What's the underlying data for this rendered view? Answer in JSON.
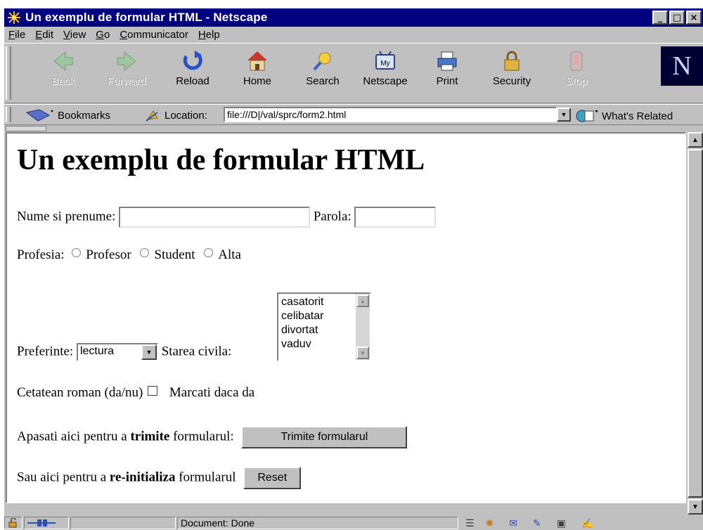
{
  "window": {
    "title": "Un exemplu de formular HTML - Netscape",
    "minimize": "_",
    "maximize": "□",
    "close": "×"
  },
  "menubar": {
    "items": [
      {
        "label": "File",
        "accel": "F",
        "rest": "ile"
      },
      {
        "label": "Edit",
        "accel": "E",
        "rest": "dit"
      },
      {
        "label": "View",
        "accel": "V",
        "rest": "iew"
      },
      {
        "label": "Go",
        "accel": "G",
        "rest": "o"
      },
      {
        "label": "Communicator",
        "accel": "C",
        "rest": "ommunicator"
      },
      {
        "label": "Help",
        "accel": "H",
        "rest": "elp"
      }
    ]
  },
  "toolbar": {
    "back": "Back",
    "forward": "Forward",
    "reload": "Reload",
    "home": "Home",
    "search": "Search",
    "netscape": "Netscape",
    "netscape_icon_text": "My",
    "print": "Print",
    "security": "Security",
    "stop": "Stop",
    "logo_letter": "N"
  },
  "locationbar": {
    "bookmarks": "Bookmarks",
    "location_label": "Location:",
    "url": "file:///D|/val/sprc/form2.html",
    "whats_related": "What's Related"
  },
  "page": {
    "heading": "Un exemplu de formular HTML",
    "name_label": "Nume si prenume:",
    "name_value": "",
    "password_label": "Parola:",
    "password_value": "",
    "profession_label": "Profesia:",
    "profession_options": [
      "Profesor",
      "Student",
      "Alta"
    ],
    "preferences_label": "Preferinte:",
    "preferences_selected": "lectura",
    "civil_status_label": "Starea civila:",
    "civil_status_options": [
      "casatorit",
      "celibatar",
      "divortat",
      "vaduv"
    ],
    "citizen_label": "Cetatean roman (da/nu)",
    "citizen_hint": "Marcati daca da",
    "submit_prefix": "Apasati aici pentru a ",
    "submit_bold": "trimite",
    "submit_suffix": " formularul:",
    "submit_button": "Trimite formularul",
    "reset_prefix": "Sau aici pentru a ",
    "reset_bold": "re-initializa",
    "reset_suffix": " formularul",
    "reset_button": "Reset"
  },
  "statusbar": {
    "text": "Document: Done"
  },
  "colors": {
    "titlebar": "#000080",
    "chrome": "#c0c0c0",
    "content_bg": "#ffffff"
  }
}
